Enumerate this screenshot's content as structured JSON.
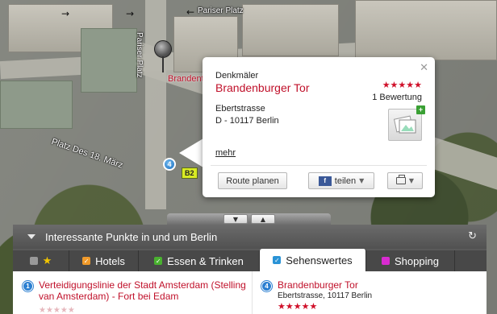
{
  "map": {
    "street_top": "Pariser Platz",
    "street_vertical": "Pariser Platz",
    "street_diagonal": "Platz Des 18. März",
    "poi_label_partial": "Brandent",
    "road_badge": "B2",
    "marker_number": "4",
    "pin_icon": "map-pin-icon"
  },
  "popup": {
    "category": "Denkmäler",
    "title": "Brandenburger Tor",
    "stars": "★★★★★",
    "rating_count": "1 Bewertung",
    "address_line1": "Ebertstrasse",
    "address_line2": "D - 10117 Berlin",
    "more_link": "mehr",
    "photo_plus": "+",
    "route_button": "Route planen",
    "share_button": "teilen",
    "share_icon": "f",
    "colors": {
      "title": "#c0102a",
      "stars": "#d0102a"
    }
  },
  "panel": {
    "title": "Interessante Punkte in und um Berlin",
    "tabs": [
      {
        "label": "",
        "checkbox_color": "#9a9a9a"
      },
      {
        "label": "Hotels",
        "checkbox_color": "#f09a2a"
      },
      {
        "label": "Essen & Trinken",
        "checkbox_color": "#49b12f"
      },
      {
        "label": "Sehenswertes",
        "checkbox_color": "#2a93d6"
      },
      {
        "label": "Shopping",
        "checkbox_color": "#d92bd1"
      }
    ],
    "results": [
      {
        "number": "1",
        "title": "Verteidigungslinie der Stadt Amsterdam (Stelling van Amsterdam) - Fort bei Edam",
        "stars": "★★★★★"
      },
      {
        "number": "4",
        "title": "Brandenburger Tor",
        "address": "Ebertstrasse, 10117 Berlin",
        "stars": "★★★★★"
      }
    ]
  }
}
